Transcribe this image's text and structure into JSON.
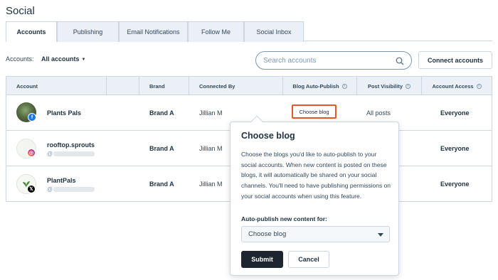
{
  "page": {
    "title": "Social"
  },
  "tabs": [
    {
      "label": "Accounts",
      "active": true
    },
    {
      "label": "Publishing",
      "active": false
    },
    {
      "label": "Email Notifications",
      "active": false
    },
    {
      "label": "Follow Me",
      "active": false
    },
    {
      "label": "Social Inbox",
      "active": false
    }
  ],
  "filter": {
    "label": "Accounts:",
    "value": "All accounts"
  },
  "search": {
    "placeholder": "Search accounts"
  },
  "actions": {
    "connect_label": "Connect accounts"
  },
  "table": {
    "headers": {
      "account": "Account",
      "brand": "Brand",
      "connected_by": "Connected By",
      "blog_auto_publish": "Blog Auto-Publish",
      "post_visibility": "Post Visibility",
      "account_access": "Account Access"
    },
    "rows": [
      {
        "name": "Plants Pals",
        "handle": "",
        "network": "facebook",
        "brand": "Brand A",
        "connected_by": "Jillian M",
        "blog_auto_publish": "Choose blog",
        "post_visibility": "All posts",
        "account_access": "Everyone"
      },
      {
        "name": "rooftop.sprouts",
        "handle": "@",
        "network": "instagram",
        "brand": "Brand A",
        "connected_by": "Jillian M",
        "blog_auto_publish": "",
        "post_visibility": "",
        "account_access": "Everyone"
      },
      {
        "name": "PlantPals",
        "handle": "@",
        "network": "x",
        "brand": "Brand A",
        "connected_by": "Jillian M",
        "blog_auto_publish": "",
        "post_visibility": "",
        "account_access": "Everyone"
      }
    ]
  },
  "popover": {
    "title": "Choose blog",
    "body": "Choose the blogs you'd like to auto-publish to your social accounts. When new content is posted on these blogs, it will automatically be shared on your social channels. You'll need to have publishing permissions on your social accounts when using this feature.",
    "select_label": "Auto-publish new content for:",
    "select_value": "Choose blog",
    "submit_label": "Submit",
    "cancel_label": "Cancel"
  },
  "colors": {
    "facebook": "#1877f2",
    "instagram": "#d6249f",
    "x": "#000000",
    "highlight": "#e3572b"
  }
}
